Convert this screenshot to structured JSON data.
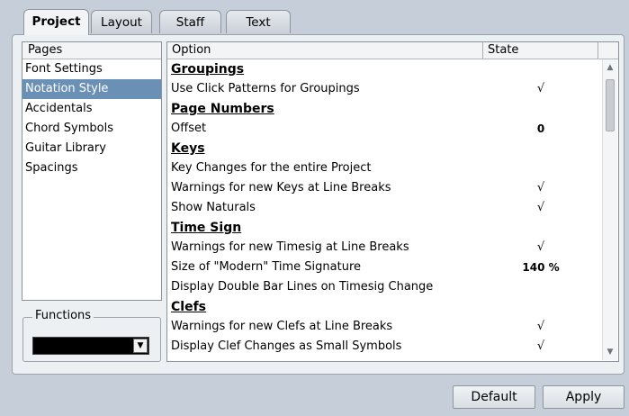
{
  "tabs": [
    {
      "label": "Project",
      "active": true
    },
    {
      "label": "Layout",
      "active": false
    },
    {
      "label": "Staff",
      "active": false
    },
    {
      "label": "Text",
      "active": false
    }
  ],
  "pages": {
    "header": "Pages",
    "items": [
      "Font Settings",
      "Notation Style",
      "Accidentals",
      "Chord Symbols",
      "Guitar Library",
      "Spacings"
    ],
    "selected_index": 1
  },
  "options": {
    "col_option": "Option",
    "col_state": "State",
    "rows": [
      {
        "type": "section",
        "label": "Groupings",
        "state": ""
      },
      {
        "type": "option",
        "label": "Use Click Patterns for Groupings",
        "state": "√"
      },
      {
        "type": "section",
        "label": "Page Numbers",
        "state": ""
      },
      {
        "type": "option",
        "label": "Offset",
        "state": "0"
      },
      {
        "type": "section",
        "label": "Keys",
        "state": ""
      },
      {
        "type": "option",
        "label": "Key Changes for the entire Project",
        "state": ""
      },
      {
        "type": "option",
        "label": "Warnings for new Keys at Line Breaks",
        "state": "√"
      },
      {
        "type": "option",
        "label": "Show Naturals",
        "state": "√"
      },
      {
        "type": "section",
        "label": "Time Sign",
        "state": ""
      },
      {
        "type": "option",
        "label": "Warnings for new Timesig at Line Breaks",
        "state": "√"
      },
      {
        "type": "option",
        "label": "Size of \"Modern\" Time Signature",
        "state": "140 %"
      },
      {
        "type": "option",
        "label": "Display Double Bar Lines on Timesig Change",
        "state": ""
      },
      {
        "type": "section",
        "label": "Clefs",
        "state": ""
      },
      {
        "type": "option",
        "label": "Warnings for new Clefs at Line Breaks",
        "state": "√"
      },
      {
        "type": "option",
        "label": "Display Clef Changes as Small Symbols",
        "state": "√"
      }
    ]
  },
  "functions": {
    "title": "Functions",
    "value": ""
  },
  "buttons": {
    "default_label": "Default",
    "apply_label": "Apply"
  },
  "icons": {
    "scroll_up": "scroll-up-arrow-icon",
    "scroll_down": "scroll-down-arrow-icon",
    "dropdown": "chevron-down-icon"
  },
  "colors": {
    "selection": "#6b90b5",
    "panel_bg": "#edf0f3",
    "window_bg": "#c5ced9"
  }
}
